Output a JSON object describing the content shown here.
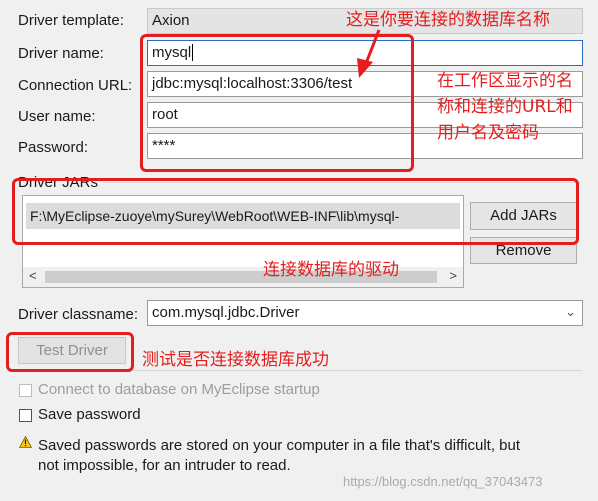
{
  "form": {
    "driver_template": {
      "label": "Driver template:",
      "value": "Axion"
    },
    "driver_name": {
      "label": "Driver name:",
      "value": "mysql"
    },
    "connection_url": {
      "label": "Connection URL:",
      "value": "jdbc:mysql:localhost:3306/test"
    },
    "user_name": {
      "label": "User name:",
      "value": "root"
    },
    "password": {
      "label": "Password:",
      "value": "****"
    }
  },
  "driver_jars": {
    "title": "Driver JARs",
    "entry": "F:\\MyEclipse-zuoye\\mySurey\\WebRoot\\WEB-INF\\lib\\mysql-",
    "add_label": "Add JARs",
    "remove_label": "Remove",
    "scroll_left": "<",
    "scroll_right": ">"
  },
  "driver_classname": {
    "label": "Driver classname:",
    "value": "com.mysql.jdbc.Driver"
  },
  "test_driver_label": "Test Driver",
  "options": {
    "connect_startup": "Connect to database on MyEclipse startup",
    "save_password": "Save password"
  },
  "warning": {
    "line1": "Saved passwords are stored on your computer in a file that's difficult, but",
    "line2": "not impossible, for an intruder to read."
  },
  "annotations": {
    "db_name": "这是你要连接的数据库名称",
    "workspace_line1": "在工作区显示的名",
    "workspace_line2": "称和连接的URL和",
    "workspace_line3": "用户名及密码",
    "driver": "连接数据库的驱动",
    "test": "测试是否连接数据库成功"
  },
  "watermark": "https://blog.csdn.net/qq_37043473",
  "colors": {
    "annotation": "#e41e1e",
    "focus": "#2a6cc4"
  }
}
